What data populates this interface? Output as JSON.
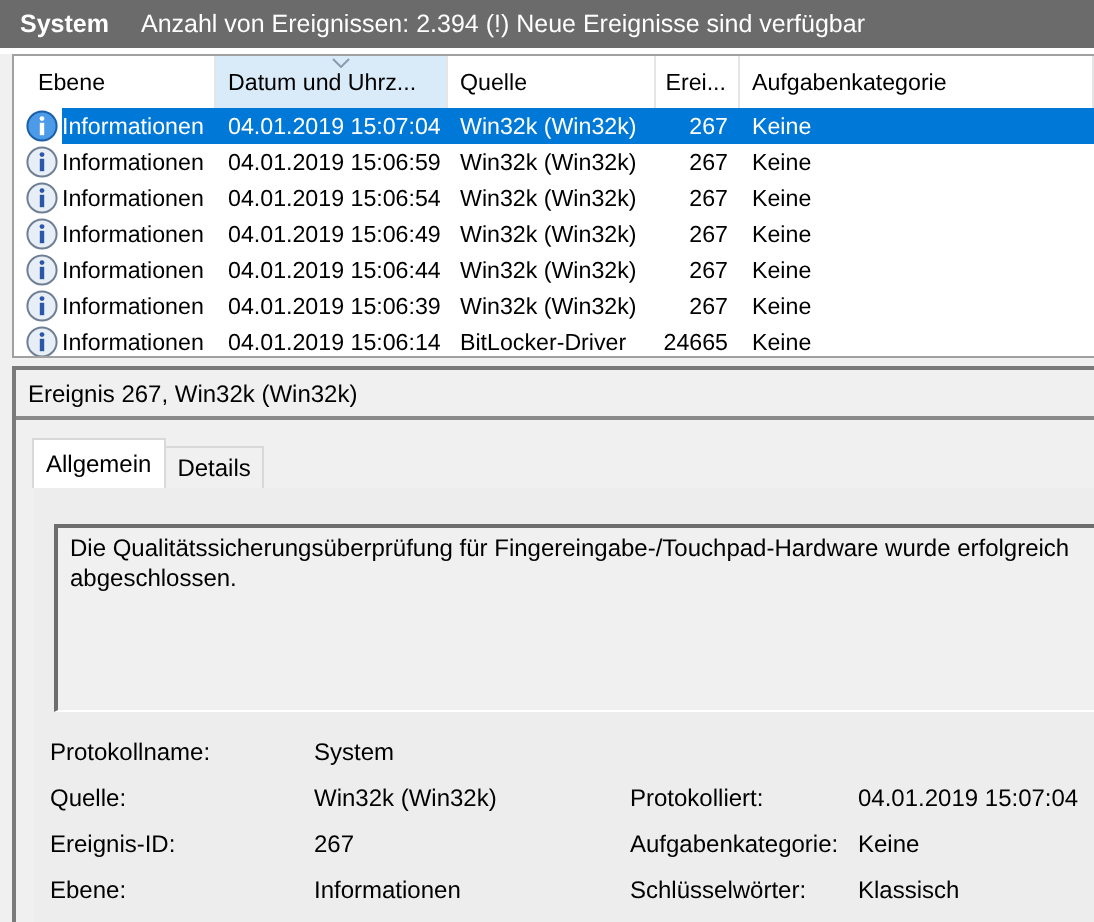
{
  "header": {
    "title": "System",
    "summary": "Anzahl von Ereignissen: 2.394 (!) Neue Ereignisse sind verfügbar"
  },
  "table": {
    "columns": [
      {
        "label": "Ebene",
        "sorted": false
      },
      {
        "label": "Datum und Uhrz...",
        "sorted": true
      },
      {
        "label": "Quelle",
        "sorted": false
      },
      {
        "label": "Erei...",
        "sorted": false
      },
      {
        "label": "Aufgabenkategorie",
        "sorted": false
      }
    ],
    "rows": [
      {
        "selected": true,
        "cells": [
          "Informationen",
          "04.01.2019 15:07:04",
          "Win32k (Win32k)",
          "267",
          "Keine"
        ]
      },
      {
        "selected": false,
        "cells": [
          "Informationen",
          "04.01.2019 15:06:59",
          "Win32k (Win32k)",
          "267",
          "Keine"
        ]
      },
      {
        "selected": false,
        "cells": [
          "Informationen",
          "04.01.2019 15:06:54",
          "Win32k (Win32k)",
          "267",
          "Keine"
        ]
      },
      {
        "selected": false,
        "cells": [
          "Informationen",
          "04.01.2019 15:06:49",
          "Win32k (Win32k)",
          "267",
          "Keine"
        ]
      },
      {
        "selected": false,
        "cells": [
          "Informationen",
          "04.01.2019 15:06:44",
          "Win32k (Win32k)",
          "267",
          "Keine"
        ]
      },
      {
        "selected": false,
        "cells": [
          "Informationen",
          "04.01.2019 15:06:39",
          "Win32k (Win32k)",
          "267",
          "Keine"
        ]
      },
      {
        "selected": false,
        "cells": [
          "Informationen",
          "04.01.2019 15:06:14",
          "BitLocker-Driver",
          "24665",
          "Keine"
        ]
      }
    ]
  },
  "detail": {
    "title": "Ereignis 267, Win32k (Win32k)",
    "tabs": [
      {
        "label": "Allgemein",
        "selected": true
      },
      {
        "label": "Details",
        "selected": false
      }
    ],
    "description": "Die Qualitätssicherungsüberprüfung für Fingereingabe-/Touchpad-Hardware wurde erfolgreich abgeschlossen.",
    "properties": [
      [
        {
          "label": "Protokollname:",
          "value": "System"
        }
      ],
      [
        {
          "label": "Quelle:",
          "value": "Win32k (Win32k)"
        },
        {
          "label": "Protokolliert:",
          "value": "04.01.2019 15:07:04"
        }
      ],
      [
        {
          "label": "Ereignis-ID:",
          "value": "267"
        },
        {
          "label": "Aufgabenkategorie:",
          "value": "Keine"
        }
      ],
      [
        {
          "label": "Ebene:",
          "value": "Informationen"
        },
        {
          "label": "Schlüsselwörter:",
          "value": "Klassisch"
        }
      ]
    ]
  }
}
